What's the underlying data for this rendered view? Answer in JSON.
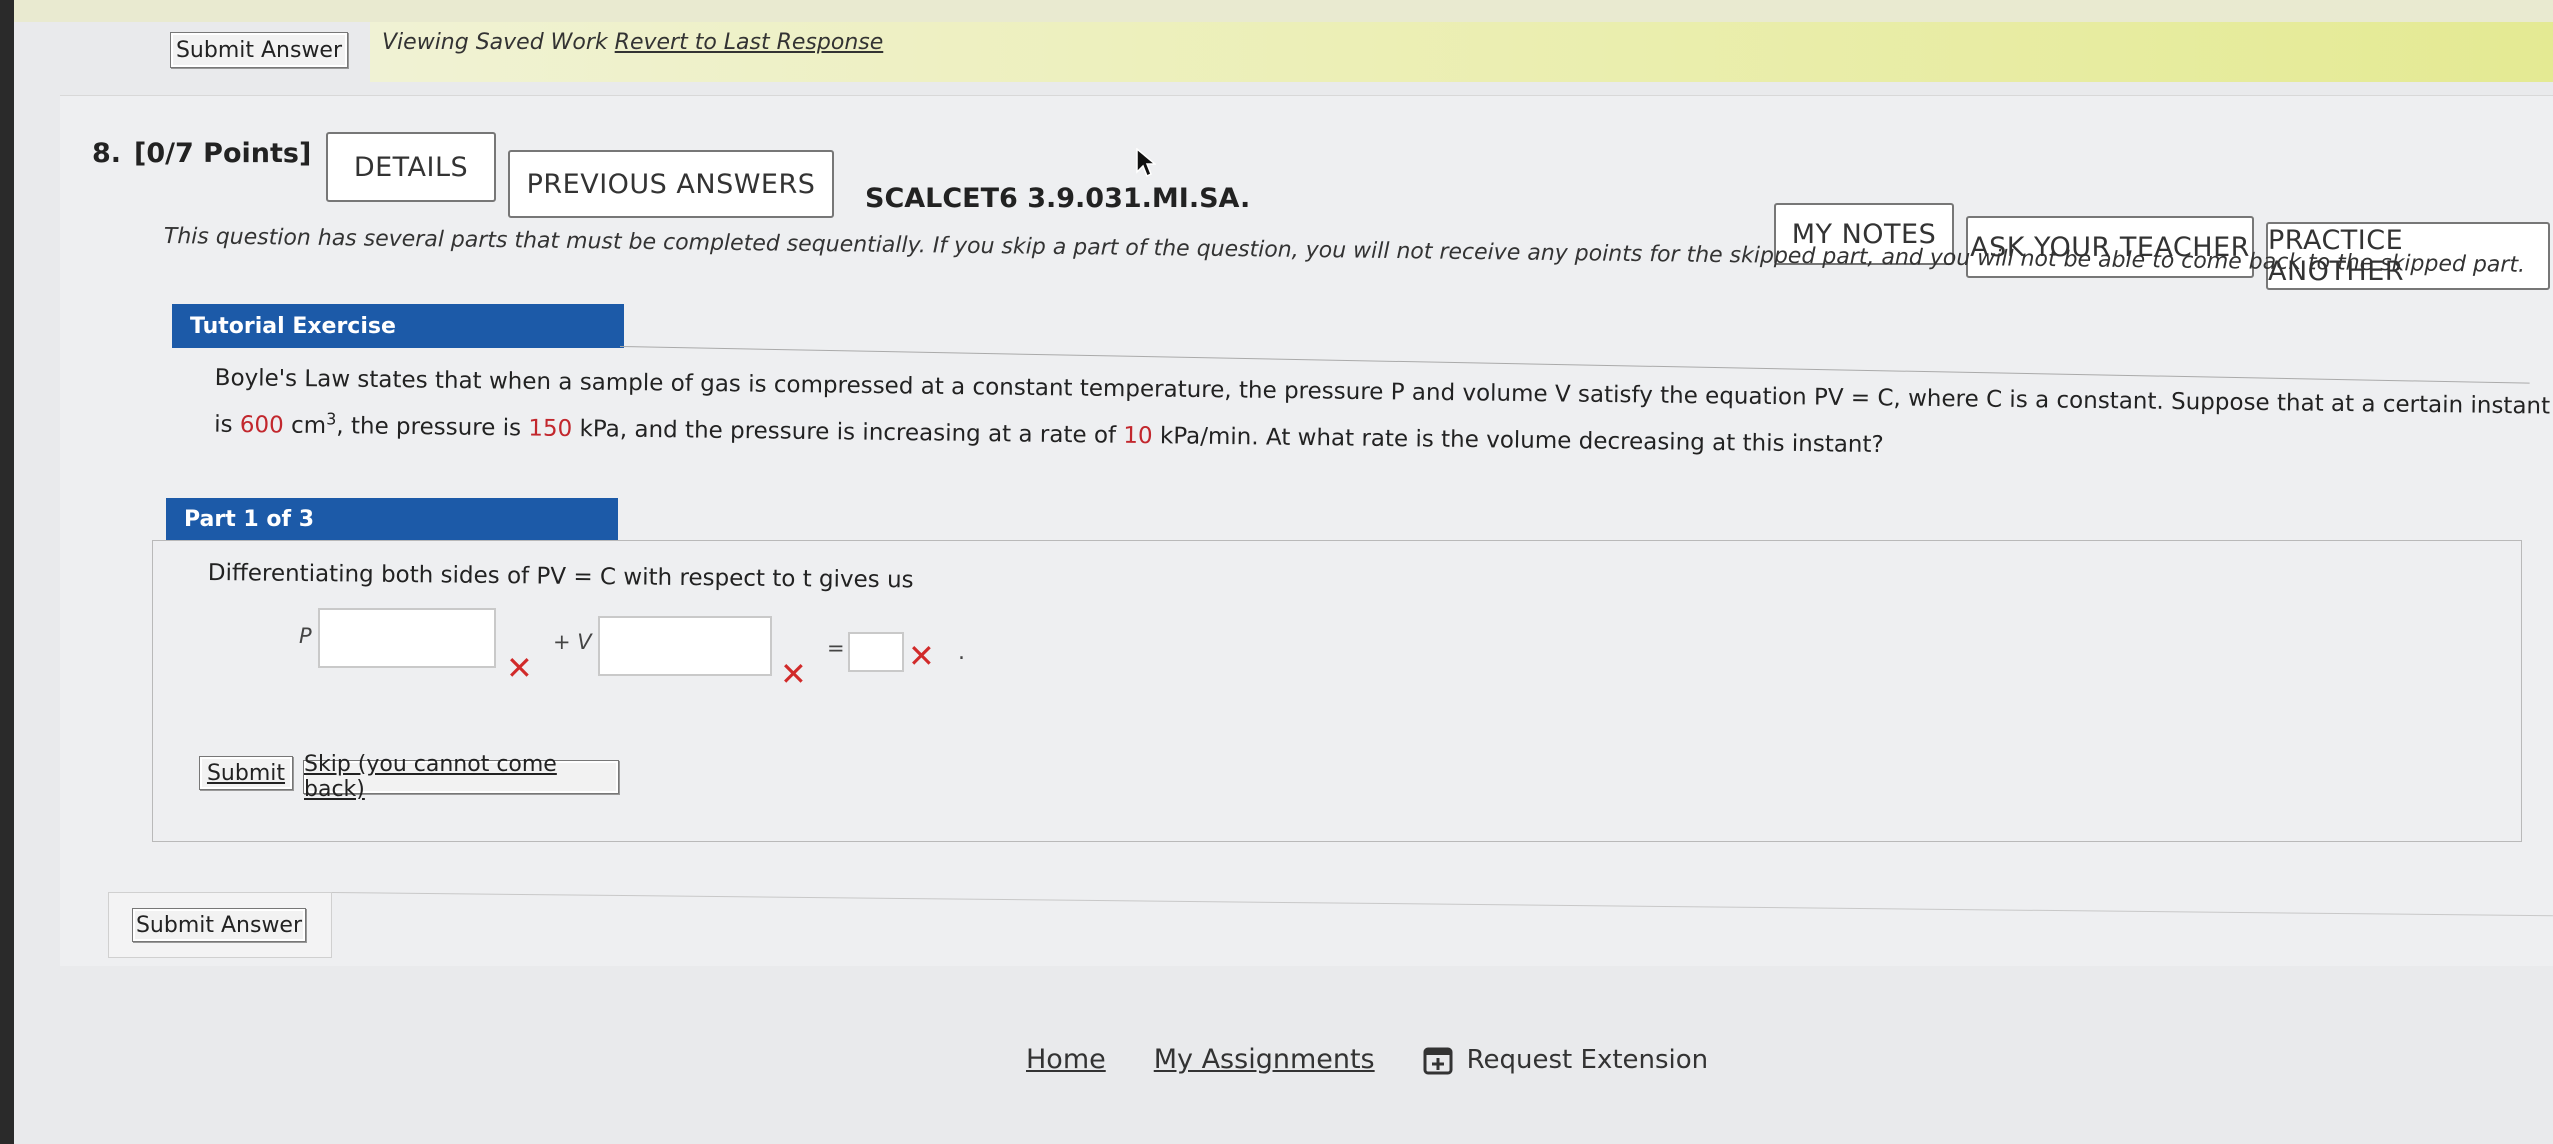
{
  "top": {
    "submit_answer": "Submit Answer",
    "viewing_saved_work": "Viewing Saved Work",
    "revert_link": "Revert to Last Response"
  },
  "question": {
    "number": "8.",
    "points": "[0/7 Points]",
    "details_btn": "DETAILS",
    "previous_answers_btn": "PREVIOUS ANSWERS",
    "code": "SCALCET6 3.9.031.MI.SA.",
    "my_notes_btn": "MY NOTES",
    "ask_teacher_btn": "ASK YOUR TEACHER",
    "practice_another_btn": "PRACTICE ANOTHER",
    "instructions": "This question has several parts that must be completed sequentially. If you skip a part of the question, you will not receive any points for the skipped part, and you will not be able to come back to the skipped part."
  },
  "tutorial": {
    "header": "Tutorial Exercise",
    "line1": "Boyle's Law states that when a sample of gas is compressed at a constant temperature, the pressure P and volume V satisfy the equation PV = C, where C is a constant. Suppose that at a certain instant the volume",
    "line2_is": "is ",
    "volume_value": "600",
    "volume_unit": " cm",
    "volume_exp": "3",
    "line2_a": ", the pressure is ",
    "pressure_value": "150",
    "line2_b": " kPa, and the pressure is increasing at a rate of ",
    "rate_value": "10",
    "line2_c": " kPa/min. At what rate is the volume decreasing at this instant?"
  },
  "part": {
    "header": "Part 1 of 3",
    "prompt": "Differentiating both sides of PV = C with respect to t gives us",
    "label_p": "P",
    "label_plus_v": "+ V",
    "label_equals": "=",
    "period": ".",
    "inputs": [
      "",
      "",
      ""
    ],
    "submit_btn": "Submit",
    "skip_btn": "Skip (you cannot come back)"
  },
  "bottom": {
    "submit_answer": "Submit Answer"
  },
  "footer": {
    "home": "Home",
    "my_assignments": "My Assignments",
    "request_extension": "Request Extension"
  },
  "colors": {
    "header_bar": "#1c5aa8",
    "highlight_red": "#c2272d",
    "incorrect_x": "#d12a2a",
    "banner_yellow": "#e4ea93"
  },
  "icons": [
    "incorrect-x-icon",
    "calendar-plus-icon",
    "mouse-cursor-icon"
  ]
}
